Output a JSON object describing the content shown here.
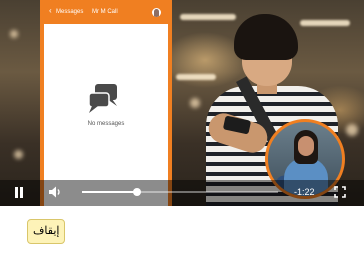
{
  "video": {
    "phone_header": {
      "back_label": "Messages",
      "contact_name": "Mr M Call"
    },
    "empty_state": "No messages",
    "controls": {
      "progress": 0.28,
      "time_remaining": "-1:22"
    }
  },
  "stop_button": {
    "label": "إيقاف"
  },
  "colors": {
    "accent": "#f07f21",
    "stop_button_bg": "#fdf3b8"
  },
  "icons": [
    "back-chevron-icon",
    "chat-bubbles-icon",
    "pause-icon",
    "volume-icon",
    "fullscreen-icon"
  ]
}
